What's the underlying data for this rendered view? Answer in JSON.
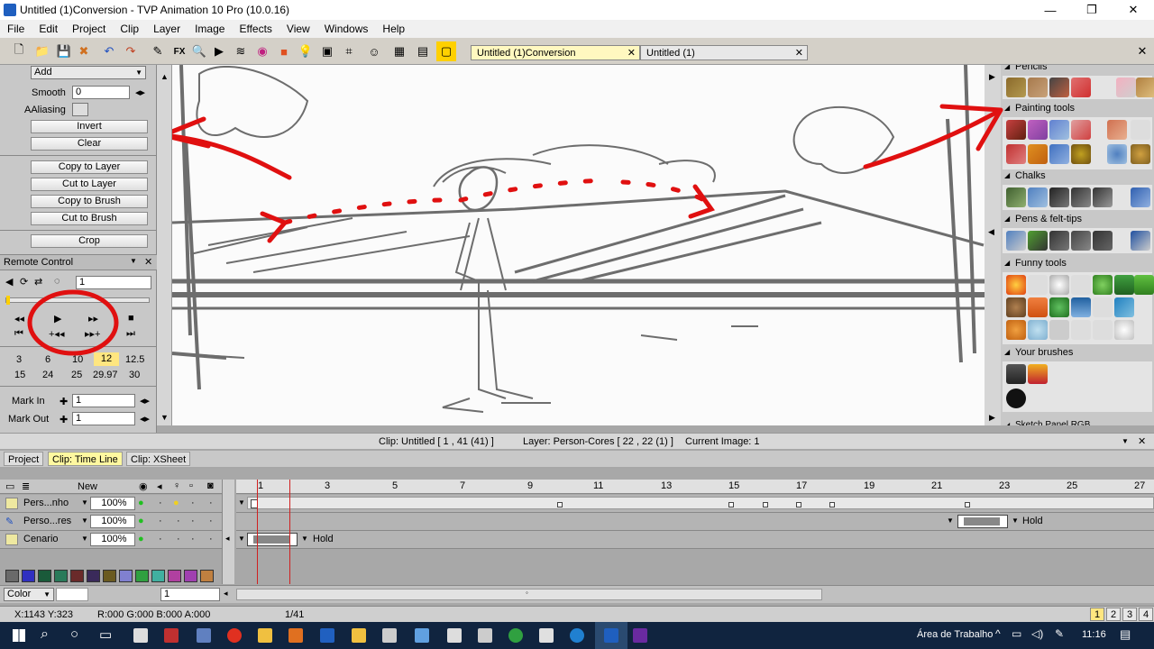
{
  "window": {
    "title": "Untitled (1)Conversion - TVP Animation 10 Pro (10.0.16)"
  },
  "menu": [
    "File",
    "Edit",
    "Project",
    "Clip",
    "Layer",
    "Image",
    "Effects",
    "View",
    "Windows",
    "Help"
  ],
  "doc_tabs": [
    {
      "label": "Untitled (1)Conversion",
      "active": true
    },
    {
      "label": "Untitled (1)",
      "active": false
    }
  ],
  "left_panel": {
    "mode_select": "Add",
    "smooth_label": "Smooth",
    "smooth_value": "0",
    "aaliasing_label": "AAliasing",
    "invert": "Invert",
    "clear": "Clear",
    "copy_to_layer": "Copy to Layer",
    "cut_to_layer": "Cut to Layer",
    "copy_to_brush": "Copy to Brush",
    "cut_to_brush": "Cut to Brush",
    "crop": "Crop"
  },
  "remote": {
    "title": "Remote Control",
    "frame_value": "1",
    "fps_row1": [
      "3",
      "6",
      "10",
      "12",
      "12.5"
    ],
    "fps_row2": [
      "15",
      "24",
      "25",
      "29.97",
      "30"
    ],
    "selected_fps": "12",
    "mark_in_label": "Mark In",
    "mark_in_value": "1",
    "mark_out_label": "Mark Out",
    "mark_out_value": "1"
  },
  "right_panel": {
    "sections": [
      "Pencils",
      "Painting tools",
      "Chalks",
      "Pens & felt-tips",
      "Funny tools",
      "Your brushes",
      "Sketch Panel RGB"
    ]
  },
  "status": {
    "clip": "Clip: Untitled [ 1 , 41  (41) ]",
    "layer": "Layer: Person-Cores [ 22 , 22  (1) ]",
    "image": "Current Image: 1"
  },
  "panel_tabs": [
    "Project",
    "Clip: Time Line",
    "Clip: XSheet"
  ],
  "timeline": {
    "header_new": "New",
    "header_z": "Z",
    "ruler": [
      "1",
      "3",
      "5",
      "7",
      "9",
      "11",
      "13",
      "15",
      "17",
      "19",
      "21",
      "23",
      "25",
      "27"
    ],
    "layers": [
      {
        "name": "Pers...nho",
        "opacity": "100%"
      },
      {
        "name": "Perso...res",
        "opacity": "100%"
      },
      {
        "name": "Cenario",
        "opacity": "100%"
      }
    ],
    "hold_label_1": "Hold",
    "hold_label_2": "Hold",
    "color_label": "Color",
    "color_value": "1"
  },
  "bottom": {
    "coords": "X:1143  Y:323",
    "rgba": "R:000 G:000 B:000 A:000",
    "frame": "1/41",
    "pages": [
      "1",
      "2",
      "3",
      "4"
    ]
  },
  "taskbar": {
    "desktop_label": "Área de Trabalho",
    "time": "11:16"
  }
}
